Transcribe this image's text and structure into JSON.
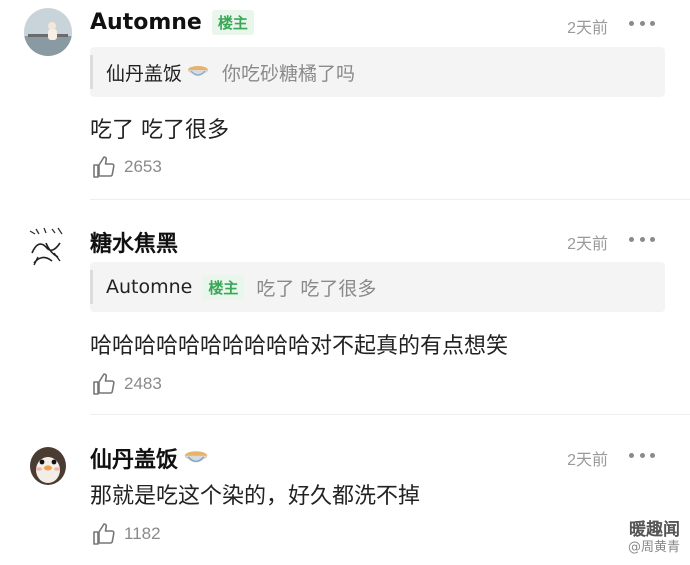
{
  "comments": [
    {
      "author": "Automne",
      "op_badge": "楼主",
      "time": "2天前",
      "quote": {
        "author": "仙丹盖饭",
        "text": "你吃砂糖橘了吗"
      },
      "text": "吃了 吃了很多",
      "likes": "2653"
    },
    {
      "author": "糖水焦黑",
      "time": "2天前",
      "quote": {
        "author": "Automne",
        "badge": "楼主",
        "text": "吃了 吃了很多"
      },
      "text": "哈哈哈哈哈哈哈哈哈哈对不起真的有点想笑",
      "likes": "2483"
    },
    {
      "author": "仙丹盖饭",
      "time": "2天前",
      "text": "那就是吃这个染的，好久都洗不掉",
      "likes": "1182"
    }
  ],
  "watermark": {
    "line1": "暖趣闻",
    "line2": "@周黄青"
  },
  "icons": {
    "like": "thumbs-up-icon",
    "more": "more-dots-icon",
    "emoji": "rice-bowl-icon"
  },
  "colors": {
    "badge_text": "#3aa757",
    "badge_bg": "#e9f6ec",
    "muted": "#9a9a9a"
  }
}
